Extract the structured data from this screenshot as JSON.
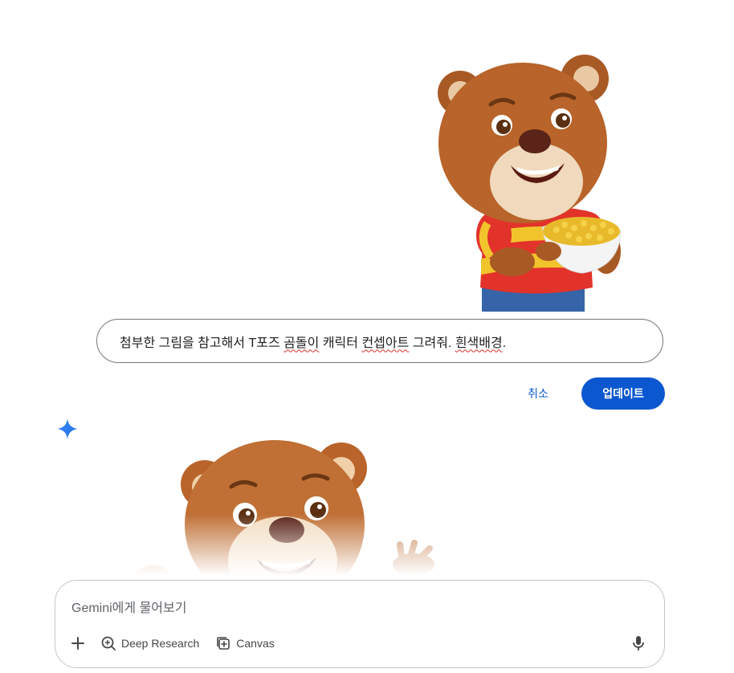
{
  "prompt": {
    "text_before": "첨부한 그림을 참고해서 T포즈 ",
    "spell1": "곰돌이",
    "text_mid1": " 캐릭터 ",
    "spell2": "컨셉아트",
    "text_mid2": " 그려줘. ",
    "spell3": "흰색배경",
    "text_end": "."
  },
  "actions": {
    "cancel_label": "취소",
    "update_label": "업데이트"
  },
  "composer": {
    "placeholder": "Gemini에게 물어보기",
    "tools": [
      {
        "label": "Deep Research",
        "icon": "deep-research-icon"
      },
      {
        "label": "Canvas",
        "icon": "canvas-icon"
      }
    ]
  },
  "icons": {
    "spark": "gemini-spark-icon",
    "add": "plus-icon",
    "mic": "microphone-icon"
  },
  "colors": {
    "accent": "#0b57d0",
    "bear_fur": "#b8642a",
    "shirt_red": "#e2332b",
    "shirt_yellow": "#f2c42c"
  }
}
